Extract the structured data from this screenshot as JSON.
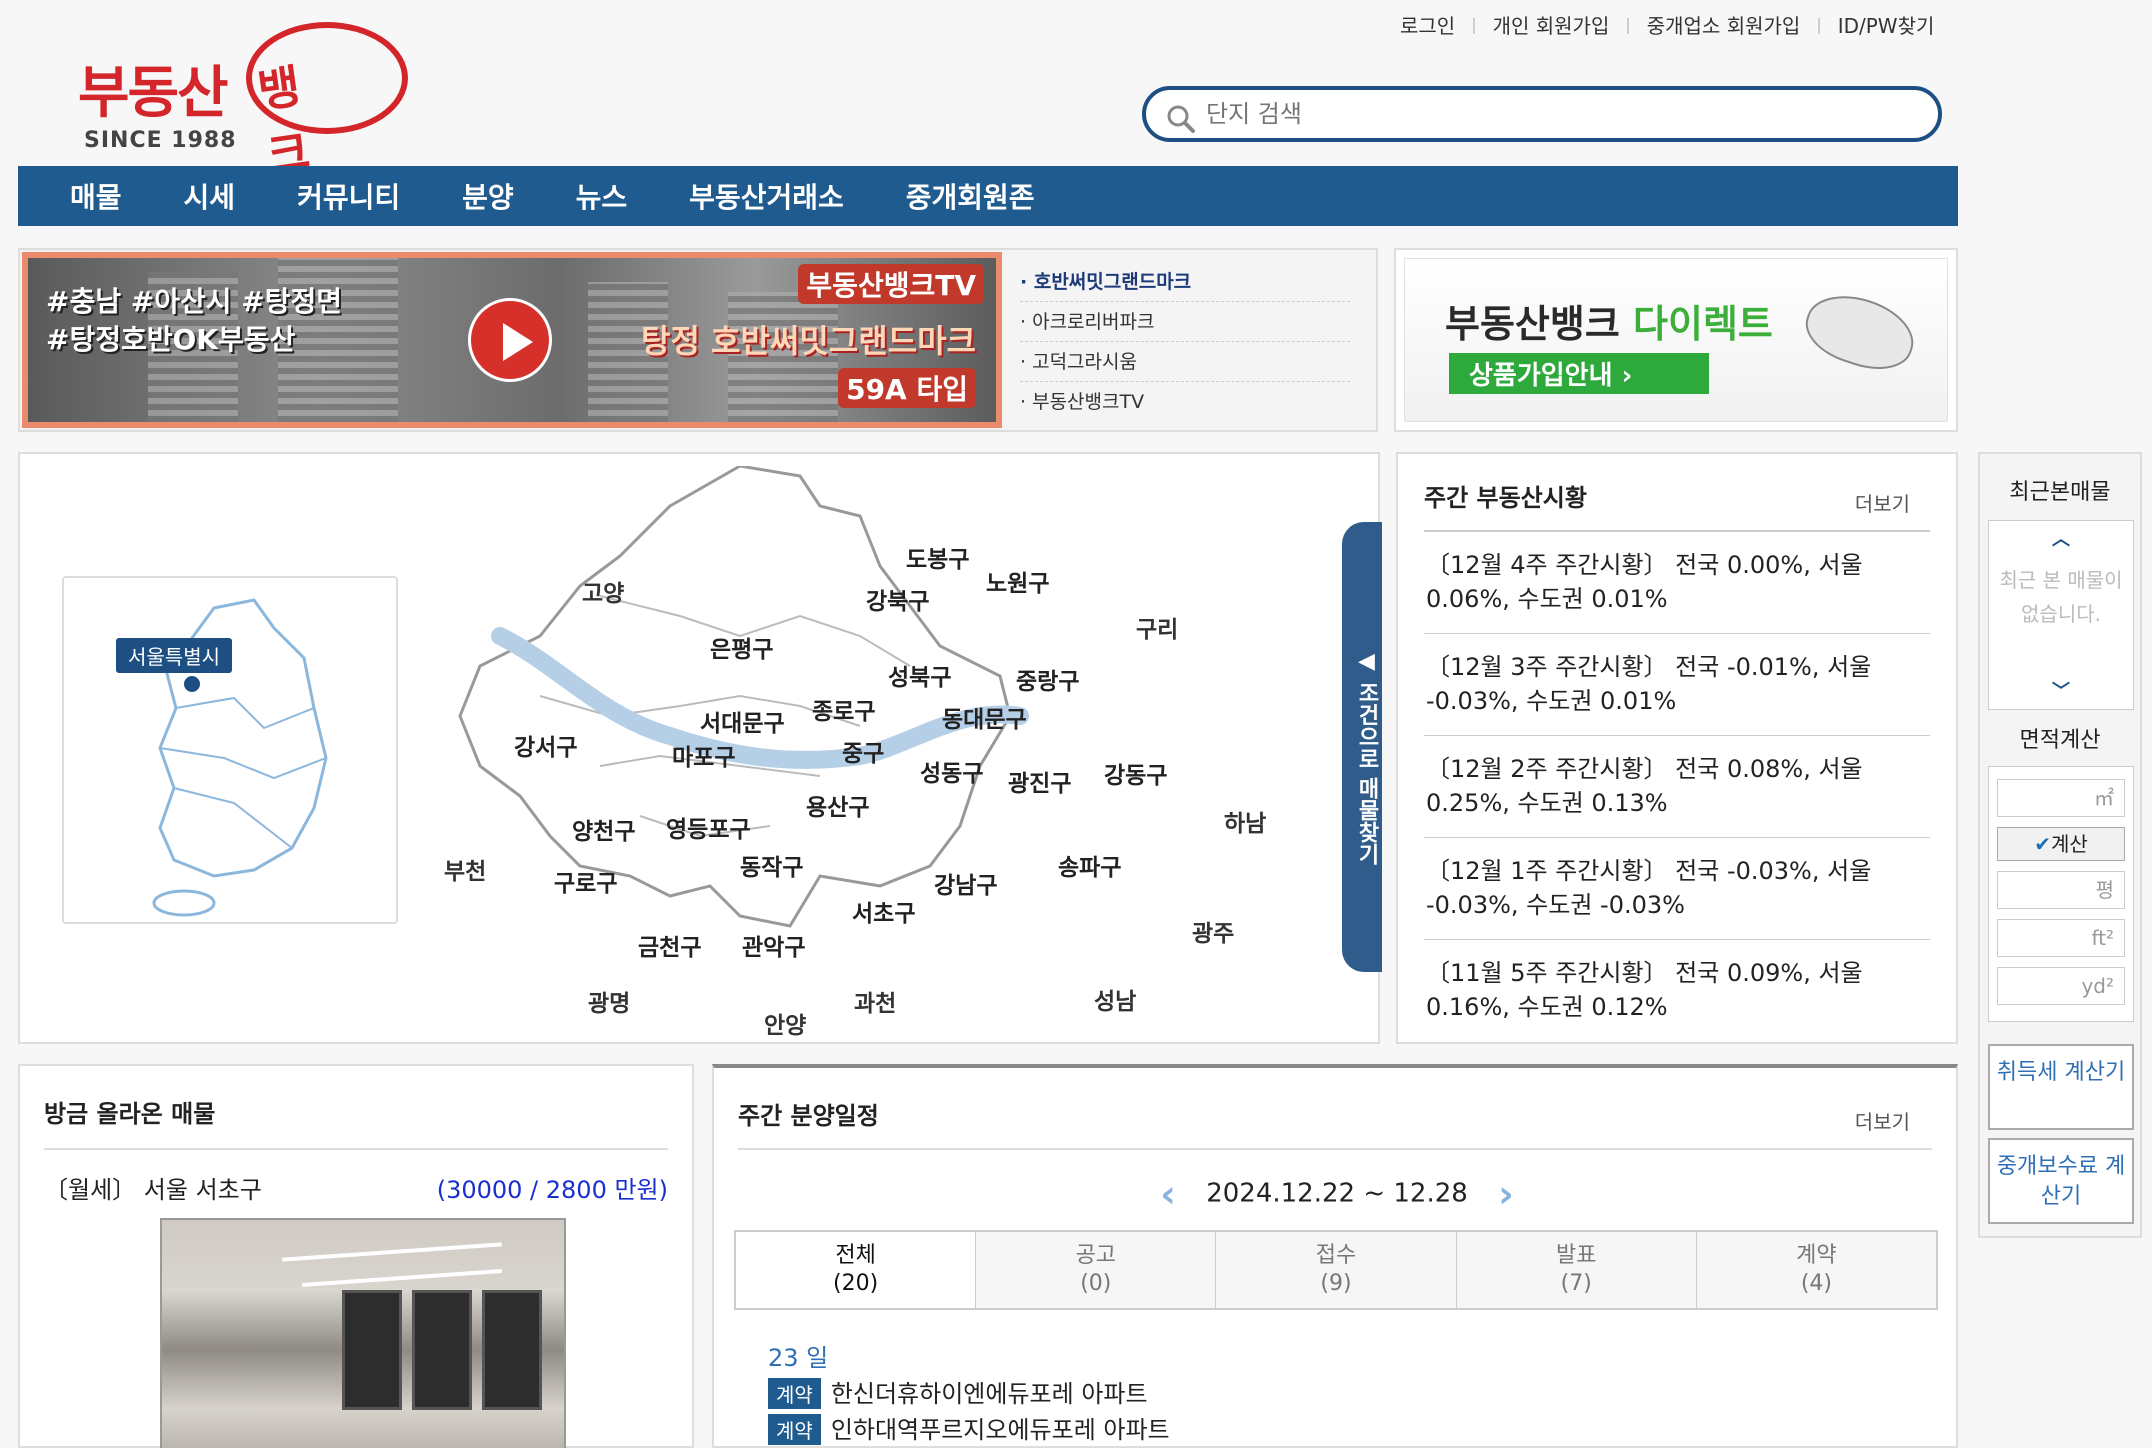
{
  "top_links": [
    "로그인",
    "개인 회원가입",
    "중개업소 회원가입",
    "ID/PW찾기"
  ],
  "logo": {
    "main": "부동산",
    "circle": "뱅크",
    "since": "SINCE 1988"
  },
  "search": {
    "placeholder": "단지 검색"
  },
  "nav": [
    "매물",
    "시세",
    "커뮤니티",
    "분양",
    "뉴스",
    "부동산거래소",
    "중개회원존"
  ],
  "tv_banner": {
    "tags": [
      "#충남 #아산시 #탕정면",
      "#탕정호반OK부동산"
    ],
    "channel": "부동산뱅크TV",
    "title": "탕정 호반써밋그랜드마크",
    "sub": "59A 타입"
  },
  "tv_list": [
    "호반써밋그랜드마크",
    "아크로리버파크",
    "고덕그라시움",
    "부동산뱅크TV"
  ],
  "direct": {
    "title_a": "부동산뱅크 ",
    "title_b": "다이렉트",
    "button": "상품가입안내 ›"
  },
  "map": {
    "seoul_tag": "서울특별시",
    "side_tab": "◀ 조건으로 매물찾기",
    "districts": [
      "도봉구",
      "노원구",
      "강북구",
      "은평구",
      "성북구",
      "중랑구",
      "종로구",
      "서대문구",
      "동대문구",
      "마포구",
      "중구",
      "강서구",
      "성동구",
      "광진구",
      "강동구",
      "용산구",
      "양천구",
      "영등포구",
      "구로구",
      "동작구",
      "송파구",
      "강남구",
      "서초구",
      "금천구",
      "관악구"
    ],
    "outer": [
      "고양",
      "구리",
      "하남",
      "부천",
      "광주",
      "광명",
      "과천",
      "성남",
      "안양"
    ]
  },
  "market": {
    "title": "주간 부동산시황",
    "more": "더보기",
    "items": [
      "〔12월 4주 주간시황〕 전국 0.00%, 서울 0.06%, 수도권 0.01%",
      "〔12월 3주 주간시황〕 전국 -0.01%, 서울 -0.03%, 수도권 0.01%",
      "〔12월 2주 주간시황〕 전국 0.08%, 서울 0.25%, 수도권 0.13%",
      "〔12월 1주 주간시황〕 전국 -0.03%, 서울 -0.03%, 수도권 -0.03%",
      "〔11월 5주 주간시황〕 전국 0.09%, 서울 0.16%, 수도권 0.12%"
    ]
  },
  "recent": {
    "title": "최근본매물",
    "empty": "최근 본 매물이 없습니다.",
    "area_title": "면적계산",
    "units": [
      "㎡",
      "평",
      "ft²",
      "yd²"
    ],
    "calc_btn": "계산",
    "tax_btn": "취득세 계산기",
    "fee_btn": "중개보수료 계산기"
  },
  "new_listing": {
    "title": "방금 올라온 매물",
    "type_loc": "〔월세〕 서울 서초구",
    "price": "(30000 / 2800 만원)"
  },
  "schedule": {
    "title": "주간 분양일정",
    "more": "더보기",
    "range": "2024.12.22 ~ 12.28",
    "tabs": [
      {
        "label": "전체",
        "count": "(20)"
      },
      {
        "label": "공고",
        "count": "(0)"
      },
      {
        "label": "접수",
        "count": "(9)"
      },
      {
        "label": "발표",
        "count": "(7)"
      },
      {
        "label": "계약",
        "count": "(4)"
      }
    ],
    "day": "23 일",
    "rows": [
      {
        "badge": "계약",
        "name": "한신더휴하이엔에듀포레 아파트"
      },
      {
        "badge": "계약",
        "name": "인하대역푸르지오에듀포레 아파트"
      }
    ]
  }
}
